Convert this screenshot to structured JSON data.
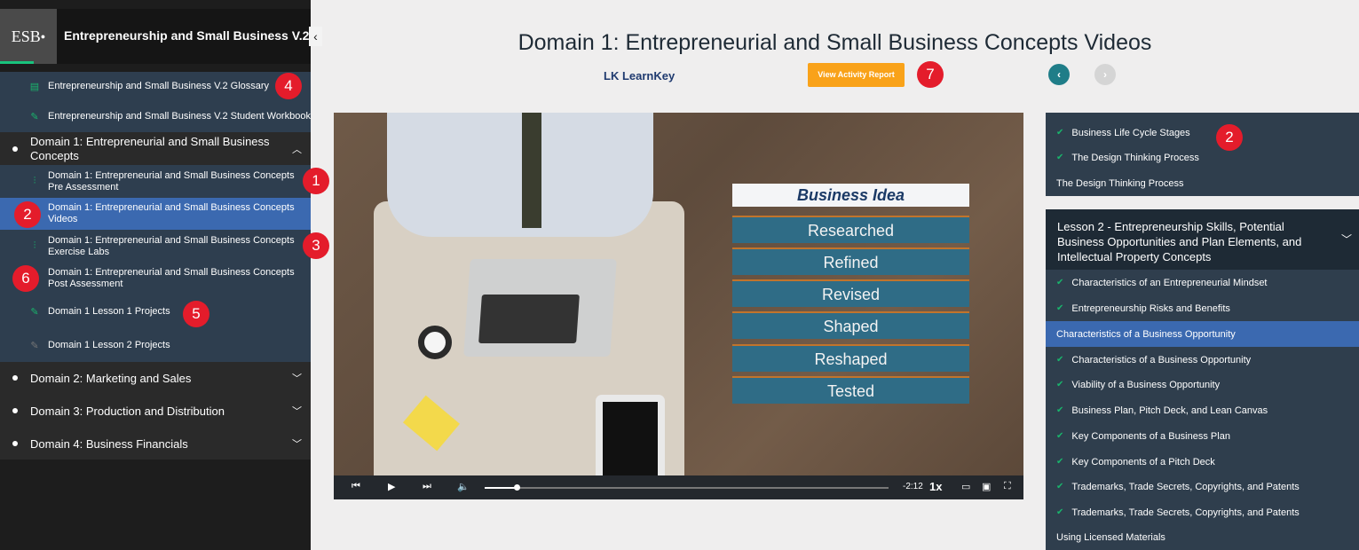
{
  "sidebar": {
    "logo": "ESB",
    "course_title": "Entrepreneurship and Small Business V.2",
    "collapse_icon": "‹",
    "items": [
      {
        "label": "Entrepreneurship and Small Business V.2 Glossary",
        "icon": "glossary-icon"
      },
      {
        "label": "Entrepreneurship and Small Business V.2 Student Workbook",
        "icon": "pencil-icon"
      },
      {
        "label": "Domain 1: Entrepreneurial and Small Business Concepts",
        "icon": "chevron-up-icon"
      },
      {
        "label": "Domain 1: Entrepreneurial and Small Business Concepts Pre Assessment",
        "icon": "assessment-icon"
      },
      {
        "label": "Domain 1: Entrepreneurial and Small Business Concepts Videos",
        "icon": "video-icon"
      },
      {
        "label": "Domain 1: Entrepreneurial and Small Business Concepts Exercise Labs",
        "icon": "lab-icon"
      },
      {
        "label": "Domain 1: Entrepreneurial and Small Business Concepts Post Assessment",
        "icon": "assessment-icon"
      },
      {
        "label": "Domain 1 Lesson 1 Projects",
        "icon": "pencil-icon"
      },
      {
        "label": "Domain 1 Lesson 2 Projects",
        "icon": "pencil-icon"
      },
      {
        "label": "Domain 2: Marketing and Sales",
        "icon": "chevron-down-icon"
      },
      {
        "label": "Domain 3: Production and Distribution",
        "icon": "chevron-down-icon"
      },
      {
        "label": "Domain 4: Business Financials",
        "icon": "chevron-down-icon"
      }
    ]
  },
  "badges": [
    "1",
    "2",
    "3",
    "4",
    "5",
    "6",
    "7",
    "2"
  ],
  "header": {
    "title": "Domain 1: Entrepreneurial and Small Business Concepts Videos",
    "brand": "LK LearnKey",
    "report_button": "View Activity Report",
    "prev_icon": "‹",
    "next_icon": "›"
  },
  "video": {
    "card_title": "Business Idea",
    "card_items": [
      "Researched",
      "Refined",
      "Revised",
      "Shaped",
      "Reshaped",
      "Tested"
    ],
    "time": "-2:12",
    "rate": "1x",
    "progress": 0.08
  },
  "right_panel": {
    "group1": [
      {
        "label": "Business Life Cycle Stages",
        "check": true
      },
      {
        "label": "The Design Thinking Process",
        "check": true
      },
      {
        "label": "The Design Thinking Process",
        "check": false
      }
    ],
    "lesson2_title": "Lesson 2 - Entrepreneurship Skills, Potential Business Opportunities and Plan Elements, and Intellectual Property Concepts",
    "group2": [
      {
        "label": "Characteristics of an Entrepreneurial Mindset",
        "check": true
      },
      {
        "label": "Entrepreneurship Risks and Benefits",
        "check": true
      },
      {
        "label": "Characteristics of a Business Opportunity",
        "check": false,
        "active": true
      },
      {
        "label": "Characteristics of a Business Opportunity",
        "check": true
      },
      {
        "label": "Viability of a Business Opportunity",
        "check": true
      },
      {
        "label": "Business Plan, Pitch Deck, and Lean Canvas",
        "check": true
      },
      {
        "label": "Key Components of a Business Plan",
        "check": true
      },
      {
        "label": "Key Components of a Pitch Deck",
        "check": true
      },
      {
        "label": "Trademarks, Trade Secrets, Copyrights, and Patents",
        "check": true
      },
      {
        "label": "Trademarks, Trade Secrets, Copyrights, and Patents",
        "check": true
      },
      {
        "label": "Using Licensed Materials",
        "check": false
      }
    ]
  },
  "colors": {
    "accent": "#3b69b0",
    "badge": "#e41c2b",
    "report": "#f9a219",
    "check": "#19b56c"
  }
}
